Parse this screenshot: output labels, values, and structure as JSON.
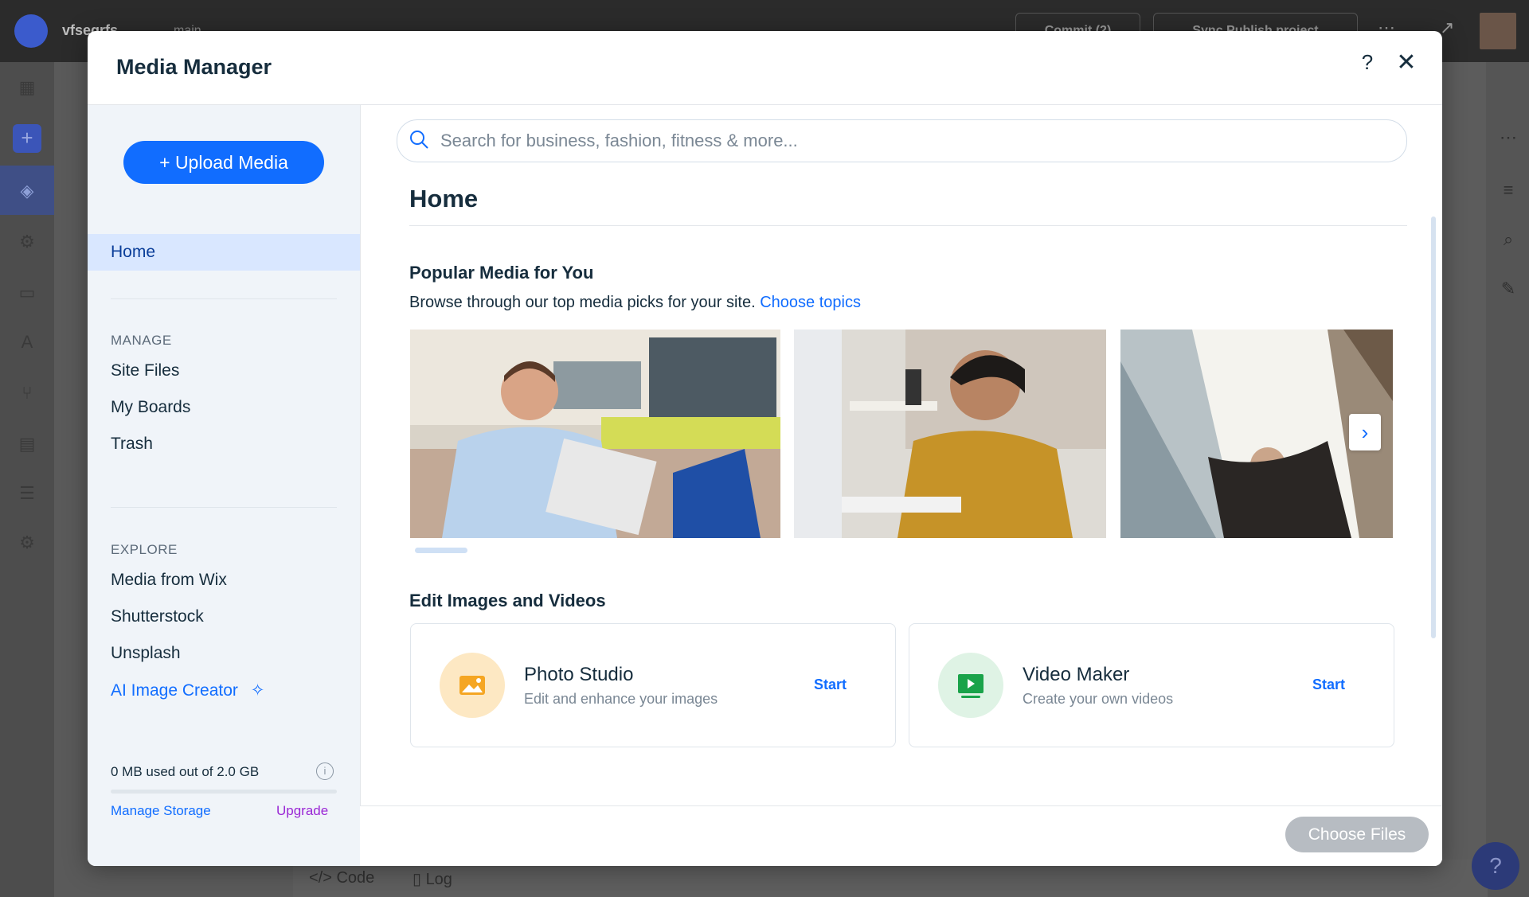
{
  "editor": {
    "site_name": "vfsegrfs",
    "branch": "main",
    "commit_label": "Commit (2)",
    "sync_label": "Sync Publish project",
    "bottom_code_label": "Code",
    "bottom_log_label": "Log",
    "help_fab": "?"
  },
  "modal": {
    "title": "Media Manager",
    "help_icon": "?",
    "close_icon": "✕"
  },
  "sidebar": {
    "upload_label": "+ Upload Media",
    "home_label": "Home",
    "manage_heading": "MANAGE",
    "manage_items": [
      "Site Files",
      "My Boards",
      "Trash"
    ],
    "explore_heading": "EXPLORE",
    "explore_items": [
      "Media from Wix",
      "Shutterstock",
      "Unsplash"
    ],
    "ai_creator_label": "AI Image Creator",
    "storage_text": "0 MB used out of 2.0 GB",
    "storage_used_fraction": 0.0,
    "manage_storage_label": "Manage Storage",
    "upgrade_label": "Upgrade"
  },
  "main": {
    "search_placeholder": "Search for business, fashion, fitness & more...",
    "page_title": "Home",
    "popular_heading": "Popular Media for You",
    "popular_desc": "Browse through our top media picks for your site.",
    "choose_topics_label": "Choose topics",
    "edit_heading": "Edit Images and Videos",
    "cards": [
      {
        "title": "Photo Studio",
        "subtitle": "Edit and enhance your images",
        "action": "Start",
        "icon": "image-icon"
      },
      {
        "title": "Video Maker",
        "subtitle": "Create your own videos",
        "action": "Start",
        "icon": "video-play-icon"
      }
    ],
    "choose_files_label": "Choose Files"
  },
  "colors": {
    "accent": "#116dff",
    "upgrade": "#9a27d5",
    "photo_icon_bg": "#fde8c3",
    "video_icon_bg": "#dff3e5",
    "disabled_button": "#b7bcc2"
  }
}
